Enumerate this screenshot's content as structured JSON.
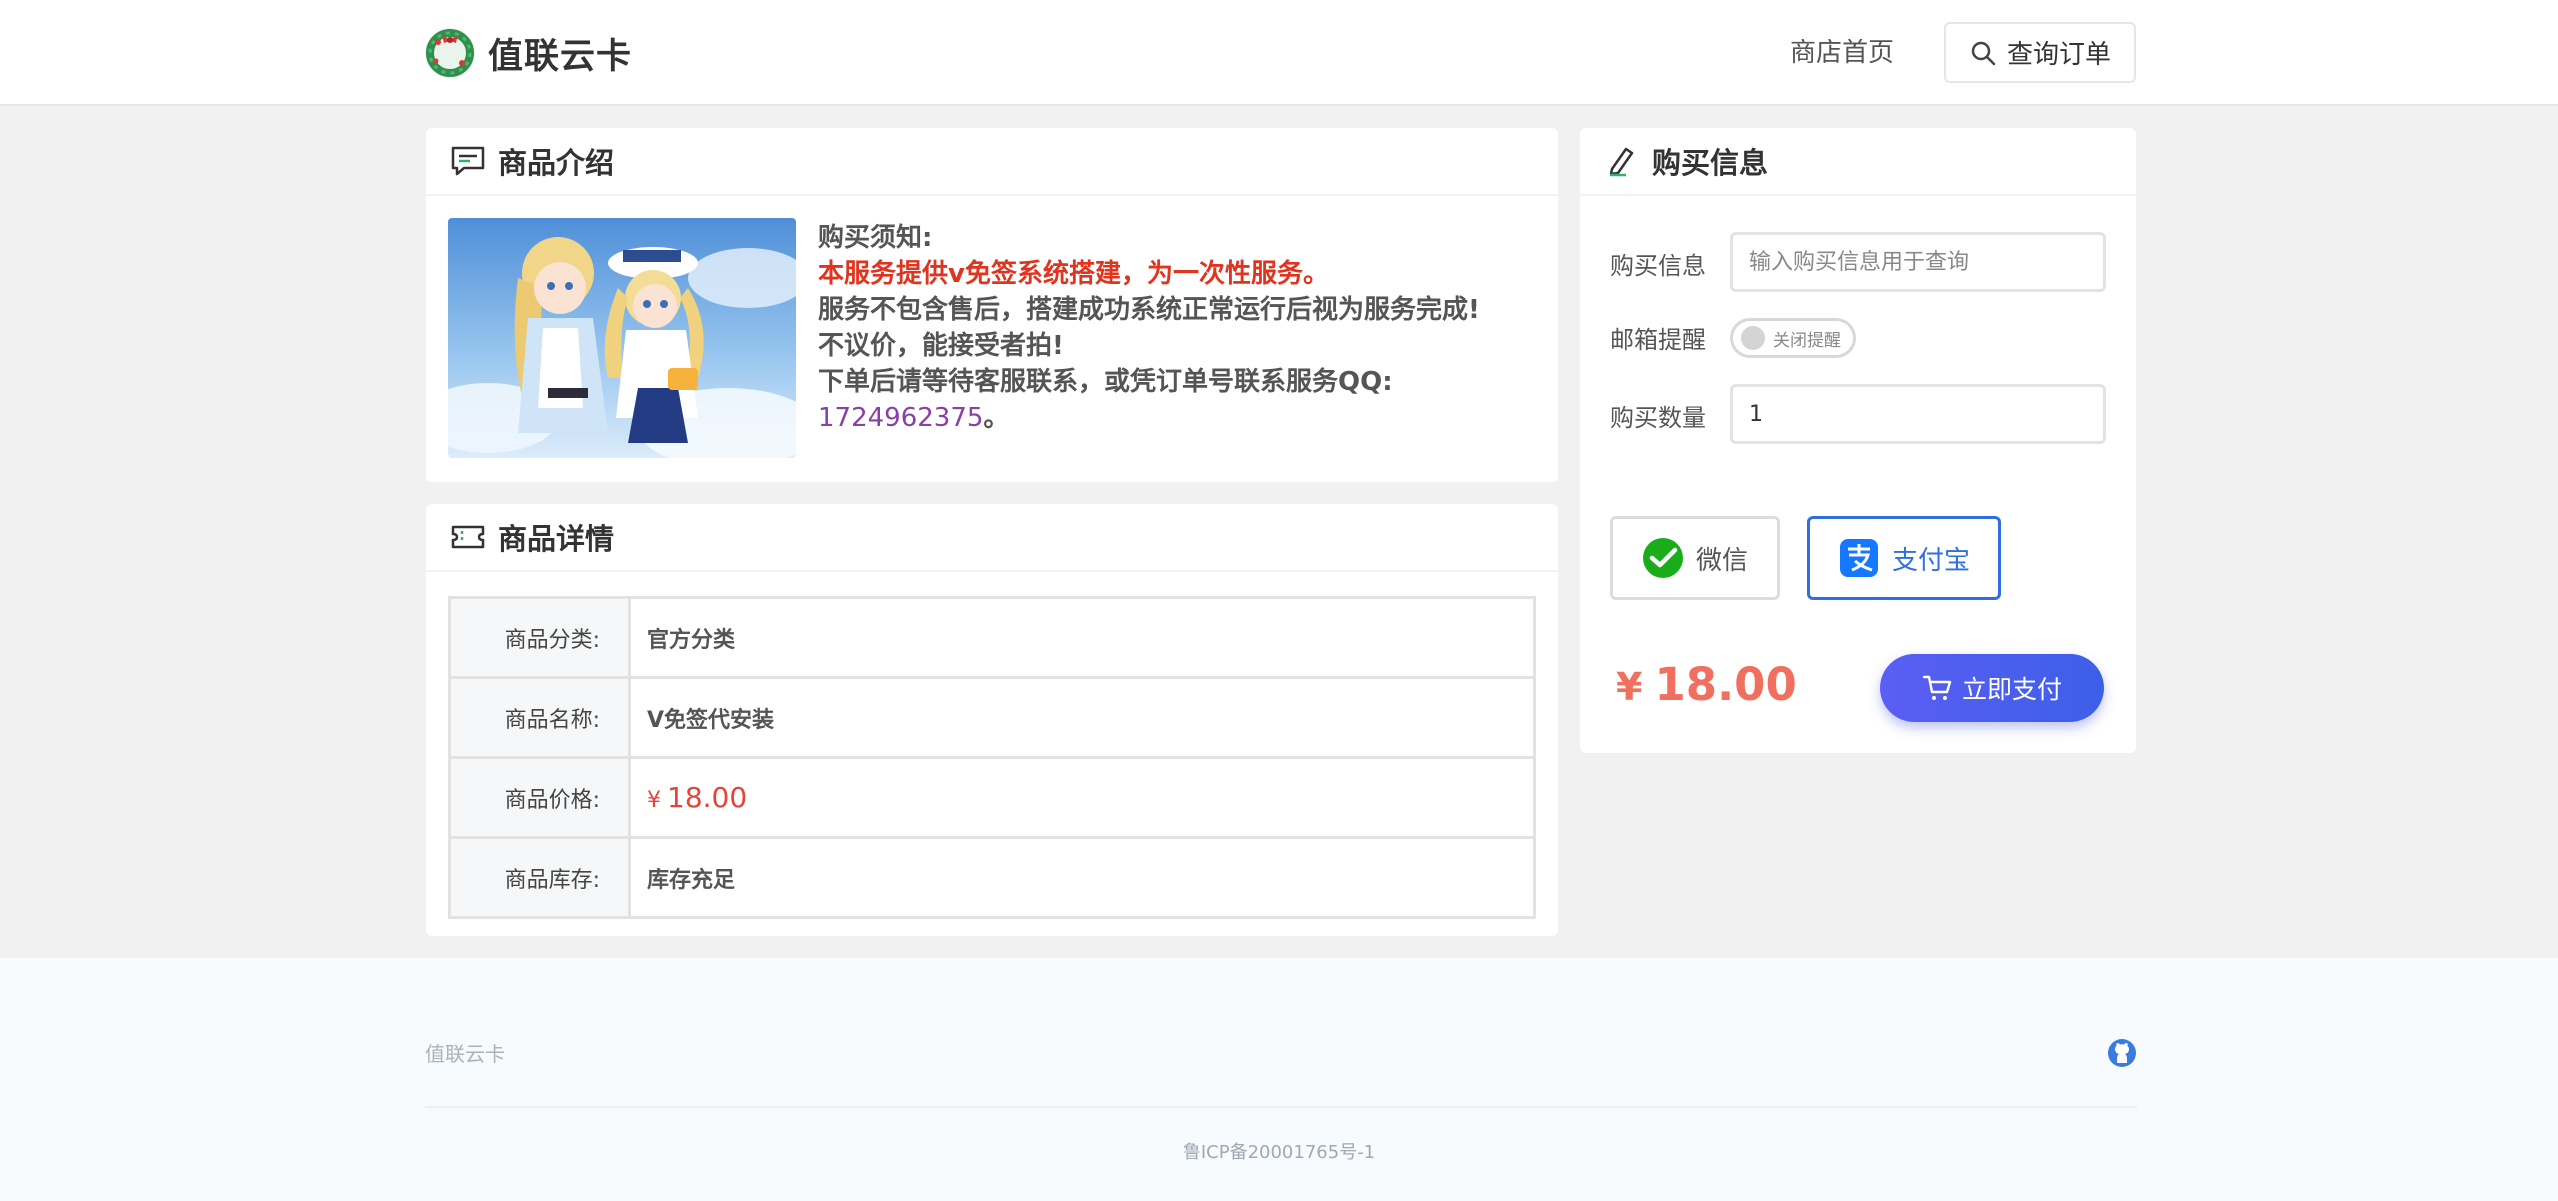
{
  "header": {
    "brand_name": "值联云卡",
    "nav_home": "商店首页",
    "nav_query": "查询订单"
  },
  "intro": {
    "title": "商品介绍",
    "notice_title": "购买须知:",
    "line_red": "本服务提供v免签系统搭建，为一次性服务。",
    "line_2": "服务不包含售后，搭建成功系统正常运行后视为服务完成!",
    "line_3": "不议价，能接受者拍!",
    "line_4": "下单后请等待客服联系，或凭订单号联系服务QQ:",
    "qq": "1724962375",
    "qq_suffix": "。"
  },
  "detail": {
    "title": "商品详情",
    "rows": [
      {
        "key": "商品分类:",
        "value": "官方分类"
      },
      {
        "key": "商品名称:",
        "value": "V免签代安装"
      },
      {
        "key": "商品价格:",
        "symbol": "¥",
        "value": "18.00"
      },
      {
        "key": "商品库存:",
        "value": "库存充足"
      }
    ]
  },
  "buy": {
    "title": "购买信息",
    "info_label": "购买信息",
    "info_placeholder": "输入购买信息用于查询",
    "email_label": "邮箱提醒",
    "email_toggle": "关闭提醒",
    "qty_label": "购买数量",
    "qty_value": "1",
    "pay_wechat": "微信",
    "pay_alipay": "支付宝",
    "total_symbol": "¥",
    "total": "18.00",
    "pay_now": "立即支付"
  },
  "footer": {
    "brand": "值联云卡",
    "icp": "鲁ICP备20001765号-1"
  },
  "colors": {
    "accent_blue": "#2f6fe0",
    "price_red": "#e5443a",
    "pay_button": "#4a5ff0",
    "wechat_green": "#1aad19",
    "alipay_blue": "#1677ff"
  }
}
